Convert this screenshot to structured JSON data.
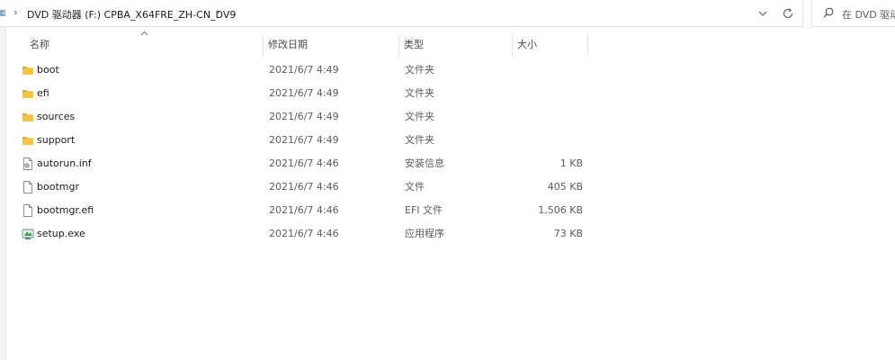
{
  "address": {
    "path": [
      "DVD 驱动器 (F:) CPBA_X64FRE_ZH-CN_DV9"
    ]
  },
  "search": {
    "placeholder": "在 DVD 驱动器"
  },
  "columns": {
    "name": "名称",
    "date": "修改日期",
    "type": "类型",
    "size": "大小"
  },
  "sort": {
    "column": "name",
    "direction": "ascending"
  },
  "files": [
    {
      "name": "boot",
      "date": "2021/6/7 4:49",
      "type": "文件夹",
      "size": "",
      "icon": "folder-icon"
    },
    {
      "name": "efi",
      "date": "2021/6/7 4:49",
      "type": "文件夹",
      "size": "",
      "icon": "folder-icon"
    },
    {
      "name": "sources",
      "date": "2021/6/7 4:49",
      "type": "文件夹",
      "size": "",
      "icon": "folder-icon"
    },
    {
      "name": "support",
      "date": "2021/6/7 4:49",
      "type": "文件夹",
      "size": "",
      "icon": "folder-icon"
    },
    {
      "name": "autorun.inf",
      "date": "2021/6/7 4:46",
      "type": "安装信息",
      "size": "1 KB",
      "icon": "setup-info-icon"
    },
    {
      "name": "bootmgr",
      "date": "2021/6/7 4:46",
      "type": "文件",
      "size": "405 KB",
      "icon": "file-icon"
    },
    {
      "name": "bootmgr.efi",
      "date": "2021/6/7 4:46",
      "type": "EFI 文件",
      "size": "1,506 KB",
      "icon": "file-icon"
    },
    {
      "name": "setup.exe",
      "date": "2021/6/7 4:46",
      "type": "应用程序",
      "size": "73 KB",
      "icon": "setup-exe-icon"
    }
  ],
  "colors": {
    "folder": "#f4c542",
    "folder_dark": "#e0a82e",
    "border": "#e1e1e1",
    "text": "#1b1b1b",
    "muted": "#5c5c5c"
  }
}
